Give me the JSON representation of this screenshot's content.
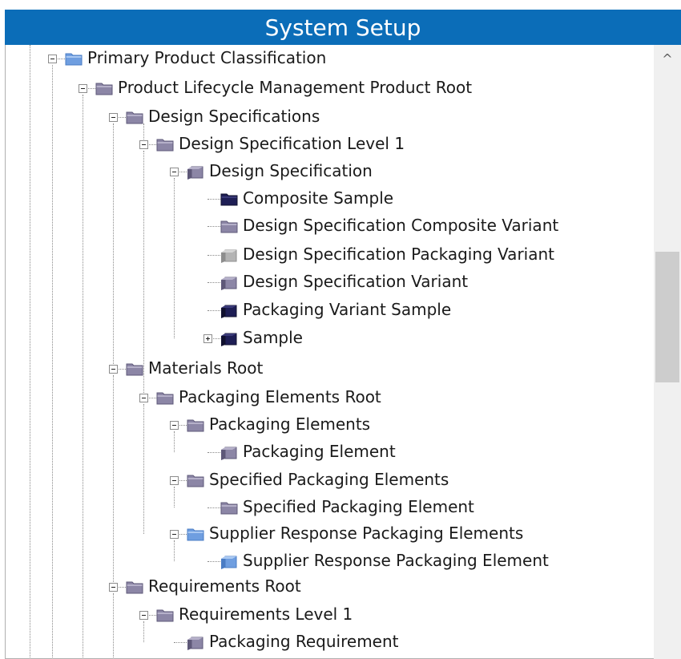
{
  "window": {
    "title": "System Setup"
  },
  "tree": {
    "nodes": [
      {
        "label": "Primary Product Classification",
        "expanded": true,
        "icon": "folder-blue-icon"
      },
      {
        "label": "Product Lifecycle Management Product Root",
        "expanded": true,
        "icon": "folder-gray-icon"
      },
      {
        "label": "Design Specifications",
        "expanded": true,
        "icon": "folder-gray-icon"
      },
      {
        "label": "Design Specification Level 1",
        "expanded": true,
        "icon": "folder-gray-icon"
      },
      {
        "label": "Design Specification",
        "expanded": true,
        "icon": "cube-gray-icon"
      },
      {
        "label": "Composite Sample",
        "expanded": null,
        "icon": "folder-navy-icon"
      },
      {
        "label": "Design Specification Composite Variant",
        "expanded": null,
        "icon": "folder-gray-icon"
      },
      {
        "label": "Design Specification Packaging Variant",
        "expanded": null,
        "icon": "cube-lightgray-icon"
      },
      {
        "label": "Design Specification Variant",
        "expanded": null,
        "icon": "cube-gray-icon"
      },
      {
        "label": "Packaging Variant Sample",
        "expanded": null,
        "icon": "cube-navy-icon"
      },
      {
        "label": "Sample",
        "expanded": false,
        "icon": "cube-navy-icon"
      },
      {
        "label": "Materials Root",
        "expanded": true,
        "icon": "folder-gray-icon"
      },
      {
        "label": "Packaging Elements Root",
        "expanded": true,
        "icon": "folder-gray-icon"
      },
      {
        "label": "Packaging Elements",
        "expanded": true,
        "icon": "folder-gray-icon"
      },
      {
        "label": "Packaging Element",
        "expanded": null,
        "icon": "cube-gray-icon"
      },
      {
        "label": "Specified Packaging Elements",
        "expanded": true,
        "icon": "folder-gray-icon"
      },
      {
        "label": "Specified Packaging Element",
        "expanded": null,
        "icon": "folder-gray-icon"
      },
      {
        "label": "Supplier Response Packaging Elements",
        "expanded": true,
        "icon": "folder-blue-icon"
      },
      {
        "label": "Supplier Response Packaging Element",
        "expanded": null,
        "icon": "cube-blue-icon"
      },
      {
        "label": "Requirements Root",
        "expanded": true,
        "icon": "folder-gray-icon"
      },
      {
        "label": "Requirements Level 1",
        "expanded": true,
        "icon": "folder-gray-icon"
      },
      {
        "label": "Packaging Requirement",
        "expanded": null,
        "icon": "cube-gray-icon"
      }
    ]
  },
  "scrollbar": {
    "up_arrow": "^",
    "position_fraction": 0.33
  },
  "colors": {
    "title_bar": "#0b6db8",
    "folder_gray": "#8c86a6",
    "folder_blue": "#6f9ee0",
    "cube_navy": "#1e1e55",
    "cube_gray": "#8880a0",
    "cube_lightgray": "#b4b4b4",
    "cube_blue": "#6f9ee0"
  }
}
